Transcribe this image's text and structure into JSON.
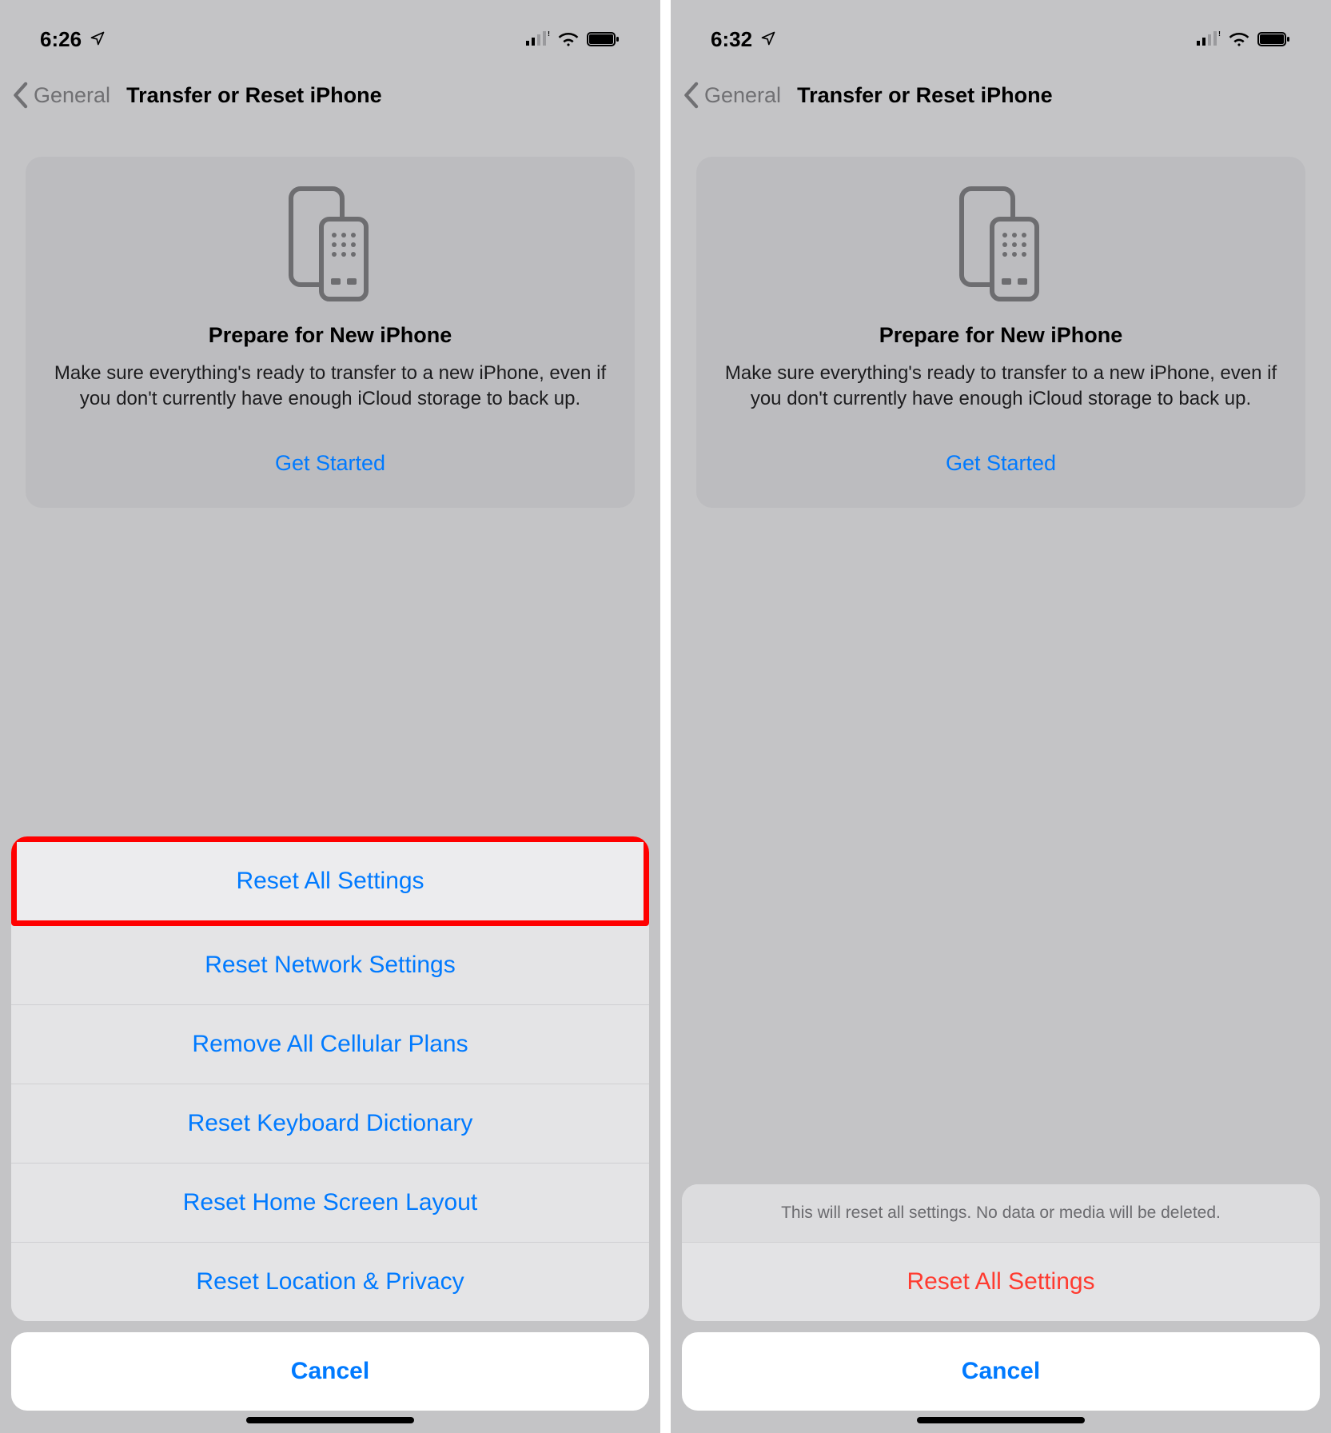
{
  "left": {
    "status": {
      "time": "6:26"
    },
    "nav": {
      "back": "General",
      "title": "Transfer or Reset iPhone"
    },
    "card": {
      "title": "Prepare for New iPhone",
      "body": "Make sure everything's ready to transfer to a new iPhone, even if you don't currently have enough iCloud storage to back up.",
      "cta": "Get Started"
    },
    "sheet": {
      "items": [
        "Reset All Settings",
        "Reset Network Settings",
        "Remove All Cellular Plans",
        "Reset Keyboard Dictionary",
        "Reset Home Screen Layout",
        "Reset Location & Privacy"
      ],
      "cancel": "Cancel"
    }
  },
  "right": {
    "status": {
      "time": "6:32"
    },
    "nav": {
      "back": "General",
      "title": "Transfer or Reset iPhone"
    },
    "card": {
      "title": "Prepare for New iPhone",
      "body": "Make sure everything's ready to transfer to a new iPhone, even if you don't currently have enough iCloud storage to back up.",
      "cta": "Get Started"
    },
    "confirm": {
      "message": "This will reset all settings. No data or media will be deleted.",
      "action": "Reset All Settings",
      "cancel": "Cancel"
    }
  }
}
